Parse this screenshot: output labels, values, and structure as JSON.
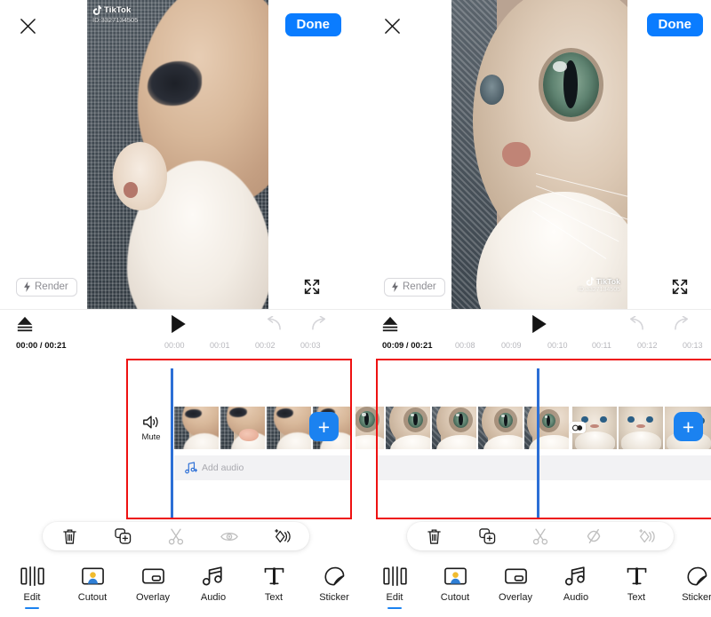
{
  "app": {
    "name": "TikTok Video Editor",
    "accent_color": "#1b82f0",
    "done_color": "#0a7cff",
    "highlight_color": "#ee1111",
    "playhead_color": "#2c6fd6"
  },
  "panels": [
    {
      "id": "left",
      "header": {
        "close_label": "×",
        "close_icon": "close-icon",
        "done_label": "Done"
      },
      "preview": {
        "render_label": "Render",
        "render_icon": "lightning-icon",
        "expand_icon": "fullscreen-icon",
        "watermark": {
          "position": "top-left",
          "name": "TikTok",
          "id": "ID:3327134505"
        }
      },
      "transport": {
        "export_icon": "eject-icon",
        "play_icon": "play-icon",
        "undo_icon": "undo-icon",
        "redo_icon": "redo-icon",
        "current_time": "00:00 / 00:21",
        "ruler_ticks": [
          "00:00",
          "00:01",
          "00:02",
          "00:03"
        ]
      },
      "timeline": {
        "mute_label": "Mute",
        "mute_icon": "speaker-icon",
        "add_audio_label": "Add audio",
        "add_audio_icon": "music-note-plus-icon",
        "add_clip_label": "+",
        "highlighted": true
      },
      "action_bar": [
        {
          "name": "delete",
          "icon": "trash-icon",
          "enabled": true
        },
        {
          "name": "duplicate",
          "icon": "copy-plus-icon",
          "enabled": true
        },
        {
          "name": "split",
          "icon": "scissors-icon",
          "enabled": false
        },
        {
          "name": "preview-visibility",
          "icon": "eye-icon",
          "enabled": false
        },
        {
          "name": "effects",
          "icon": "sparkle-shapes-icon",
          "enabled": true
        }
      ],
      "bottom_nav": [
        {
          "label": "Edit",
          "icon": "edit-clips-icon",
          "active": true
        },
        {
          "label": "Cutout",
          "icon": "cutout-person-icon",
          "active": false
        },
        {
          "label": "Overlay",
          "icon": "overlay-frame-icon",
          "active": false
        },
        {
          "label": "Audio",
          "icon": "music-note-icon",
          "active": false
        },
        {
          "label": "Text",
          "icon": "text-t-icon",
          "active": false
        },
        {
          "label": "Sticker",
          "icon": "sticker-peel-icon",
          "active": false
        }
      ]
    },
    {
      "id": "right",
      "header": {
        "close_label": "×",
        "close_icon": "close-icon",
        "done_label": "Done"
      },
      "preview": {
        "render_label": "Render",
        "render_icon": "lightning-icon",
        "expand_icon": "fullscreen-icon",
        "watermark": {
          "position": "bottom-right",
          "name": "TikTok",
          "id": "ID:3327134505"
        }
      },
      "transport": {
        "export_icon": "eject-icon",
        "play_icon": "play-icon",
        "undo_icon": "undo-icon",
        "redo_icon": "redo-icon",
        "current_time": "00:09 / 00:21",
        "ruler_ticks": [
          "00:08",
          "00:09",
          "00:10",
          "00:11",
          "00:12",
          "00:13"
        ]
      },
      "timeline": {
        "add_clip_label": "+",
        "transition_icon": "transition-icon",
        "highlighted": true
      },
      "action_bar": [
        {
          "name": "delete",
          "icon": "trash-icon",
          "enabled": true
        },
        {
          "name": "duplicate",
          "icon": "copy-plus-icon",
          "enabled": true
        },
        {
          "name": "split",
          "icon": "scissors-icon",
          "enabled": false
        },
        {
          "name": "preview-visibility",
          "icon": "eye-off-icon",
          "enabled": false
        },
        {
          "name": "effects",
          "icon": "sparkle-shapes-icon",
          "enabled": false
        }
      ],
      "bottom_nav": [
        {
          "label": "Edit",
          "icon": "edit-clips-icon",
          "active": true
        },
        {
          "label": "Cutout",
          "icon": "cutout-person-icon",
          "active": false
        },
        {
          "label": "Overlay",
          "icon": "overlay-frame-icon",
          "active": false
        },
        {
          "label": "Audio",
          "icon": "music-note-icon",
          "active": false
        },
        {
          "label": "Text",
          "icon": "text-t-icon",
          "active": false
        },
        {
          "label": "Sticker",
          "icon": "sticker-peel-icon",
          "active": false
        }
      ]
    }
  ]
}
